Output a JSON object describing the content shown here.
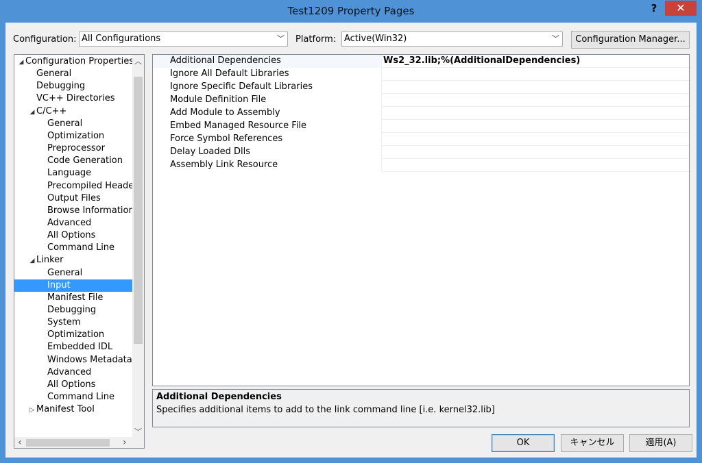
{
  "window": {
    "title": "Test1209 Property Pages",
    "help_glyph": "?",
    "close_glyph": "✕"
  },
  "toolbar": {
    "configuration_label": "Configuration:",
    "configuration_value": "All Configurations",
    "platform_label": "Platform:",
    "platform_value": "Active(Win32)",
    "config_manager_button": "Configuration Manager..."
  },
  "tree": {
    "items": [
      {
        "label": "Configuration Properties",
        "level": 0,
        "expander": "◢"
      },
      {
        "label": "General",
        "level": 1
      },
      {
        "label": "Debugging",
        "level": 1
      },
      {
        "label": "VC++ Directories",
        "level": 1
      },
      {
        "label": "C/C++",
        "level": 1,
        "expander": "◢"
      },
      {
        "label": "General",
        "level": 2
      },
      {
        "label": "Optimization",
        "level": 2
      },
      {
        "label": "Preprocessor",
        "level": 2
      },
      {
        "label": "Code Generation",
        "level": 2
      },
      {
        "label": "Language",
        "level": 2
      },
      {
        "label": "Precompiled Headers",
        "level": 2
      },
      {
        "label": "Output Files",
        "level": 2
      },
      {
        "label": "Browse Information",
        "level": 2
      },
      {
        "label": "Advanced",
        "level": 2
      },
      {
        "label": "All Options",
        "level": 2
      },
      {
        "label": "Command Line",
        "level": 2
      },
      {
        "label": "Linker",
        "level": 1,
        "expander": "◢"
      },
      {
        "label": "General",
        "level": 2
      },
      {
        "label": "Input",
        "level": 2,
        "selected": true
      },
      {
        "label": "Manifest File",
        "level": 2
      },
      {
        "label": "Debugging",
        "level": 2
      },
      {
        "label": "System",
        "level": 2
      },
      {
        "label": "Optimization",
        "level": 2
      },
      {
        "label": "Embedded IDL",
        "level": 2
      },
      {
        "label": "Windows Metadata",
        "level": 2
      },
      {
        "label": "Advanced",
        "level": 2
      },
      {
        "label": "All Options",
        "level": 2
      },
      {
        "label": "Command Line",
        "level": 2
      },
      {
        "label": "Manifest Tool",
        "level": 1,
        "expander": "▷"
      }
    ],
    "scroll_up": "︿",
    "scroll_down": "﹀",
    "scroll_left": "‹",
    "scroll_right": "›"
  },
  "grid": {
    "rows": [
      {
        "name": "Additional Dependencies",
        "value": "Ws2_32.lib;%(AdditionalDependencies)"
      },
      {
        "name": "Ignore All Default Libraries",
        "value": ""
      },
      {
        "name": "Ignore Specific Default Libraries",
        "value": ""
      },
      {
        "name": "Module Definition File",
        "value": ""
      },
      {
        "name": "Add Module to Assembly",
        "value": ""
      },
      {
        "name": "Embed Managed Resource File",
        "value": ""
      },
      {
        "name": "Force Symbol References",
        "value": ""
      },
      {
        "name": "Delay Loaded Dlls",
        "value": ""
      },
      {
        "name": "Assembly Link Resource",
        "value": ""
      }
    ]
  },
  "description": {
    "title": "Additional Dependencies",
    "text": "Specifies additional items to add to the link command line [i.e. kernel32.lib]"
  },
  "buttons": {
    "ok": "OK",
    "cancel": "キャンセル",
    "apply": "適用(A)"
  },
  "colors": {
    "titlebar": "#4f93d6",
    "close": "#c7423a",
    "selection": "#3399ff"
  }
}
